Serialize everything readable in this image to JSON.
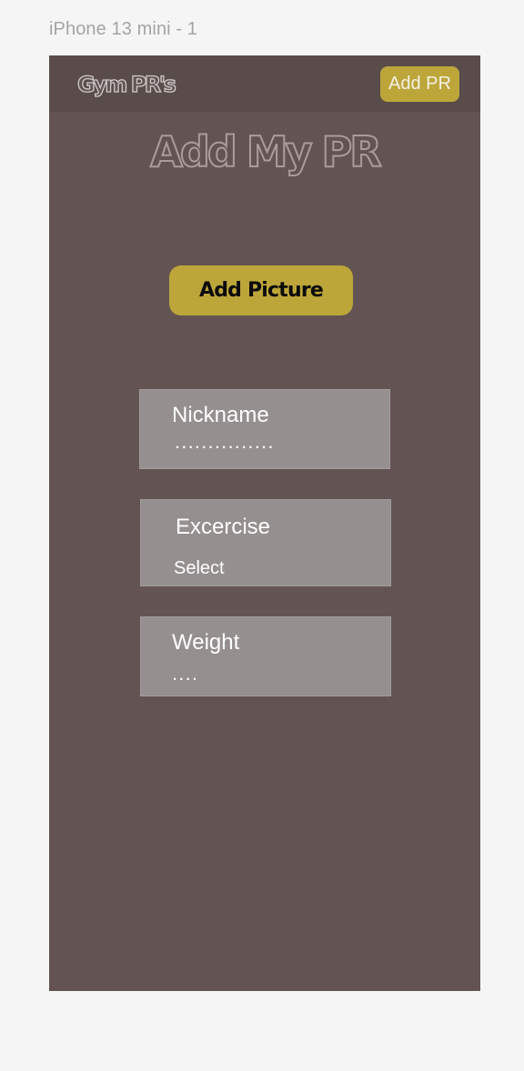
{
  "frame": {
    "label": "iPhone 13 mini - 1"
  },
  "header": {
    "brand": "Gym PR's",
    "add_pr_label": "Add PR"
  },
  "main": {
    "title": "Add My PR",
    "add_picture_label": "Add Picture",
    "fields": [
      {
        "label": "Nickname",
        "value": "..............."
      },
      {
        "label": "Excercise",
        "value": "Select"
      },
      {
        "label": "Weight",
        "value": "...."
      }
    ]
  },
  "colors": {
    "page_background": "#f5f5f5",
    "screen_background": "#635453",
    "header_background": "#594c4b",
    "accent": "#bca63a",
    "field_background": "#958f8f",
    "field_text": "#ffffff"
  }
}
